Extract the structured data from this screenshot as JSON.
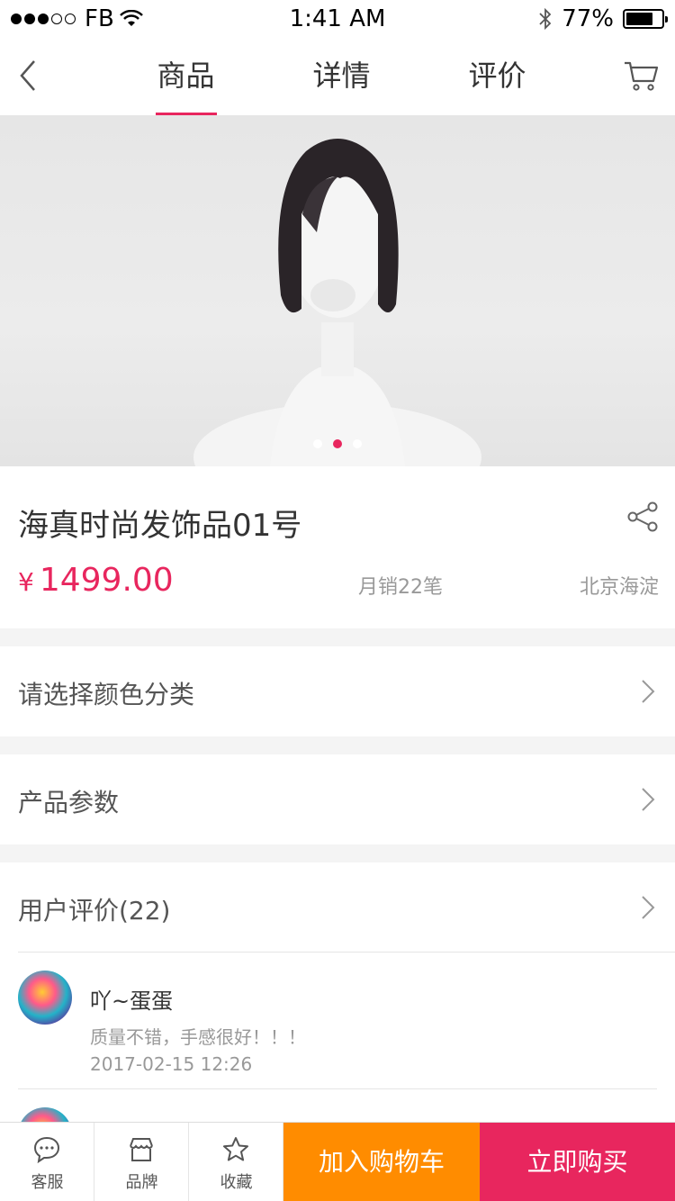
{
  "status": {
    "carrier": "FB",
    "time": "1:41 AM",
    "battery": "77%",
    "battery_level": 0.77
  },
  "nav": {
    "tabs": [
      "商品",
      "详情",
      "评价"
    ],
    "active_tab": 0
  },
  "carousel": {
    "page_count": 3,
    "current_page": 2
  },
  "product": {
    "title": "海真时尚发饰品01号",
    "currency": "¥",
    "price": "1499.00",
    "sales": "月销22笔",
    "location": "北京海淀"
  },
  "rows": {
    "color": "请选择颜色分类",
    "params": "产品参数"
  },
  "reviews": {
    "header": "用户评价(22)",
    "items": [
      {
        "user": "吖~蛋蛋",
        "text": "质量不错，手感很好！！！",
        "date": "2017-02-15 12:26"
      }
    ]
  },
  "bottom": {
    "service": "客服",
    "brand": "品牌",
    "favorite": "收藏",
    "add_to_cart": "加入购物车",
    "buy_now": "立即购买"
  },
  "colors": {
    "accent": "#e8265e",
    "cart_button": "#ff8c00"
  }
}
